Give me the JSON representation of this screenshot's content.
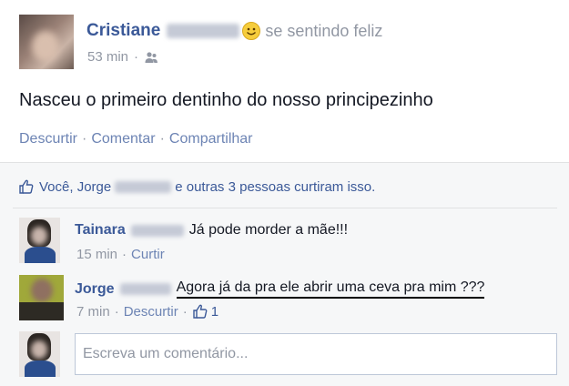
{
  "post": {
    "author_first": "Cristiane",
    "feeling": "se sentindo feliz",
    "time": "53 min",
    "text": "Nasceu o primeiro dentinho do nosso principezinho",
    "actions": {
      "unlike": "Descurtir",
      "comment": "Comentar",
      "share": "Compartilhar"
    },
    "separator": "·"
  },
  "likes": {
    "prefix": "Você, Jorge",
    "suffix": "e outras 3 pessoas curtiram isso."
  },
  "comments": [
    {
      "author": "Tainara",
      "text": "Já pode morder a mãe!!!",
      "time": "15 min",
      "action": "Curtir"
    },
    {
      "author": "Jorge",
      "text": "Agora já da pra ele abrir uma ceva pra mim ???",
      "time": "7 min",
      "action": "Descurtir",
      "like_count": "1"
    }
  ],
  "composer": {
    "placeholder": "Escreva um comentário..."
  },
  "colors": {
    "link": "#3b5998",
    "muted": "#9197a3",
    "panel": "#f6f7f8",
    "border": "#e1e2e3"
  }
}
